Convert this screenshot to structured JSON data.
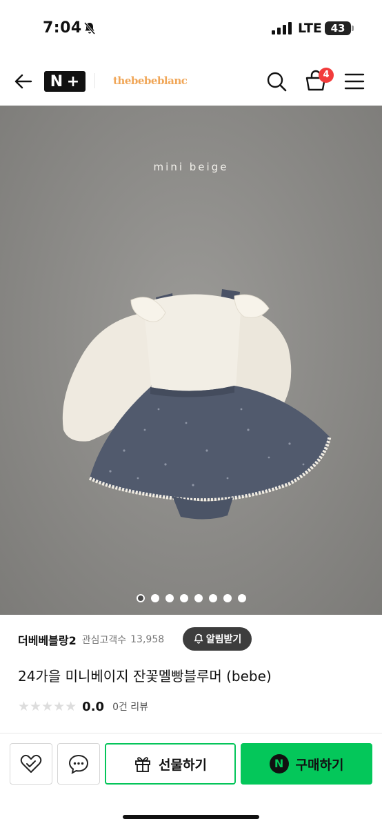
{
  "status_bar": {
    "time": "7:04",
    "network": "LTE",
    "battery": "43"
  },
  "header": {
    "nplus_left": "N",
    "nplus_right": "+",
    "brand_logo": "thebebeblanc",
    "cart_count": "4",
    "icons": [
      "back-arrow-icon",
      "search-icon",
      "cart-icon",
      "menu-icon"
    ]
  },
  "hero": {
    "caption": "mini beige",
    "total_images": 8,
    "active_image": 1
  },
  "store": {
    "name": "더베베블랑2",
    "follower_label": "관심고객수",
    "follower_count": "13,958",
    "alarm_label": "알림받기"
  },
  "product": {
    "title": "24가을 미니베이지 잔꽃멜빵블루머 (bebe)",
    "rating_value": "0.0",
    "review_count": "0건 리뷰",
    "stars_filled": 0,
    "stars_total": 5
  },
  "bottom_bar": {
    "gift_label": "선물하기",
    "buy_label": "구매하기",
    "buy_badge": "N",
    "accent_color": "#04c75a"
  }
}
